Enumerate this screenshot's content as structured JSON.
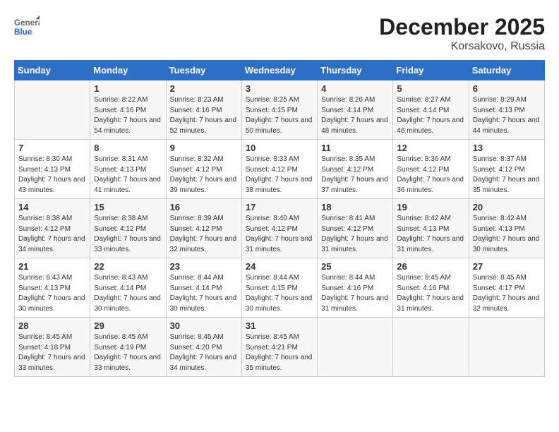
{
  "logo": {
    "general": "General",
    "blue": "Blue"
  },
  "title": "December 2025",
  "location": "Korsakovo, Russia",
  "days_header": [
    "Sunday",
    "Monday",
    "Tuesday",
    "Wednesday",
    "Thursday",
    "Friday",
    "Saturday"
  ],
  "weeks": [
    [
      {
        "num": "",
        "sunrise": "",
        "sunset": "",
        "daylight": ""
      },
      {
        "num": "1",
        "sunrise": "Sunrise: 8:22 AM",
        "sunset": "Sunset: 4:16 PM",
        "daylight": "Daylight: 7 hours and 54 minutes."
      },
      {
        "num": "2",
        "sunrise": "Sunrise: 8:23 AM",
        "sunset": "Sunset: 4:16 PM",
        "daylight": "Daylight: 7 hours and 52 minutes."
      },
      {
        "num": "3",
        "sunrise": "Sunrise: 8:25 AM",
        "sunset": "Sunset: 4:15 PM",
        "daylight": "Daylight: 7 hours and 50 minutes."
      },
      {
        "num": "4",
        "sunrise": "Sunrise: 8:26 AM",
        "sunset": "Sunset: 4:14 PM",
        "daylight": "Daylight: 7 hours and 48 minutes."
      },
      {
        "num": "5",
        "sunrise": "Sunrise: 8:27 AM",
        "sunset": "Sunset: 4:14 PM",
        "daylight": "Daylight: 7 hours and 46 minutes."
      },
      {
        "num": "6",
        "sunrise": "Sunrise: 8:29 AM",
        "sunset": "Sunset: 4:13 PM",
        "daylight": "Daylight: 7 hours and 44 minutes."
      }
    ],
    [
      {
        "num": "7",
        "sunrise": "Sunrise: 8:30 AM",
        "sunset": "Sunset: 4:13 PM",
        "daylight": "Daylight: 7 hours and 43 minutes."
      },
      {
        "num": "8",
        "sunrise": "Sunrise: 8:31 AM",
        "sunset": "Sunset: 4:13 PM",
        "daylight": "Daylight: 7 hours and 41 minutes."
      },
      {
        "num": "9",
        "sunrise": "Sunrise: 8:32 AM",
        "sunset": "Sunset: 4:12 PM",
        "daylight": "Daylight: 7 hours and 39 minutes."
      },
      {
        "num": "10",
        "sunrise": "Sunrise: 8:33 AM",
        "sunset": "Sunset: 4:12 PM",
        "daylight": "Daylight: 7 hours and 38 minutes."
      },
      {
        "num": "11",
        "sunrise": "Sunrise: 8:35 AM",
        "sunset": "Sunset: 4:12 PM",
        "daylight": "Daylight: 7 hours and 37 minutes."
      },
      {
        "num": "12",
        "sunrise": "Sunrise: 8:36 AM",
        "sunset": "Sunset: 4:12 PM",
        "daylight": "Daylight: 7 hours and 36 minutes."
      },
      {
        "num": "13",
        "sunrise": "Sunrise: 8:37 AM",
        "sunset": "Sunset: 4:12 PM",
        "daylight": "Daylight: 7 hours and 35 minutes."
      }
    ],
    [
      {
        "num": "14",
        "sunrise": "Sunrise: 8:38 AM",
        "sunset": "Sunset: 4:12 PM",
        "daylight": "Daylight: 7 hours and 34 minutes."
      },
      {
        "num": "15",
        "sunrise": "Sunrise: 8:38 AM",
        "sunset": "Sunset: 4:12 PM",
        "daylight": "Daylight: 7 hours and 33 minutes."
      },
      {
        "num": "16",
        "sunrise": "Sunrise: 8:39 AM",
        "sunset": "Sunset: 4:12 PM",
        "daylight": "Daylight: 7 hours and 32 minutes."
      },
      {
        "num": "17",
        "sunrise": "Sunrise: 8:40 AM",
        "sunset": "Sunset: 4:12 PM",
        "daylight": "Daylight: 7 hours and 31 minutes."
      },
      {
        "num": "18",
        "sunrise": "Sunrise: 8:41 AM",
        "sunset": "Sunset: 4:12 PM",
        "daylight": "Daylight: 7 hours and 31 minutes."
      },
      {
        "num": "19",
        "sunrise": "Sunrise: 8:42 AM",
        "sunset": "Sunset: 4:13 PM",
        "daylight": "Daylight: 7 hours and 31 minutes."
      },
      {
        "num": "20",
        "sunrise": "Sunrise: 8:42 AM",
        "sunset": "Sunset: 4:13 PM",
        "daylight": "Daylight: 7 hours and 30 minutes."
      }
    ],
    [
      {
        "num": "21",
        "sunrise": "Sunrise: 8:43 AM",
        "sunset": "Sunset: 4:13 PM",
        "daylight": "Daylight: 7 hours and 30 minutes."
      },
      {
        "num": "22",
        "sunrise": "Sunrise: 8:43 AM",
        "sunset": "Sunset: 4:14 PM",
        "daylight": "Daylight: 7 hours and 30 minutes."
      },
      {
        "num": "23",
        "sunrise": "Sunrise: 8:44 AM",
        "sunset": "Sunset: 4:14 PM",
        "daylight": "Daylight: 7 hours and 30 minutes."
      },
      {
        "num": "24",
        "sunrise": "Sunrise: 8:44 AM",
        "sunset": "Sunset: 4:15 PM",
        "daylight": "Daylight: 7 hours and 30 minutes."
      },
      {
        "num": "25",
        "sunrise": "Sunrise: 8:44 AM",
        "sunset": "Sunset: 4:16 PM",
        "daylight": "Daylight: 7 hours and 31 minutes."
      },
      {
        "num": "26",
        "sunrise": "Sunrise: 8:45 AM",
        "sunset": "Sunset: 4:16 PM",
        "daylight": "Daylight: 7 hours and 31 minutes."
      },
      {
        "num": "27",
        "sunrise": "Sunrise: 8:45 AM",
        "sunset": "Sunset: 4:17 PM",
        "daylight": "Daylight: 7 hours and 32 minutes."
      }
    ],
    [
      {
        "num": "28",
        "sunrise": "Sunrise: 8:45 AM",
        "sunset": "Sunset: 4:18 PM",
        "daylight": "Daylight: 7 hours and 33 minutes."
      },
      {
        "num": "29",
        "sunrise": "Sunrise: 8:45 AM",
        "sunset": "Sunset: 4:19 PM",
        "daylight": "Daylight: 7 hours and 33 minutes."
      },
      {
        "num": "30",
        "sunrise": "Sunrise: 8:45 AM",
        "sunset": "Sunset: 4:20 PM",
        "daylight": "Daylight: 7 hours and 34 minutes."
      },
      {
        "num": "31",
        "sunrise": "Sunrise: 8:45 AM",
        "sunset": "Sunset: 4:21 PM",
        "daylight": "Daylight: 7 hours and 35 minutes."
      },
      {
        "num": "",
        "sunrise": "",
        "sunset": "",
        "daylight": ""
      },
      {
        "num": "",
        "sunrise": "",
        "sunset": "",
        "daylight": ""
      },
      {
        "num": "",
        "sunrise": "",
        "sunset": "",
        "daylight": ""
      }
    ]
  ]
}
